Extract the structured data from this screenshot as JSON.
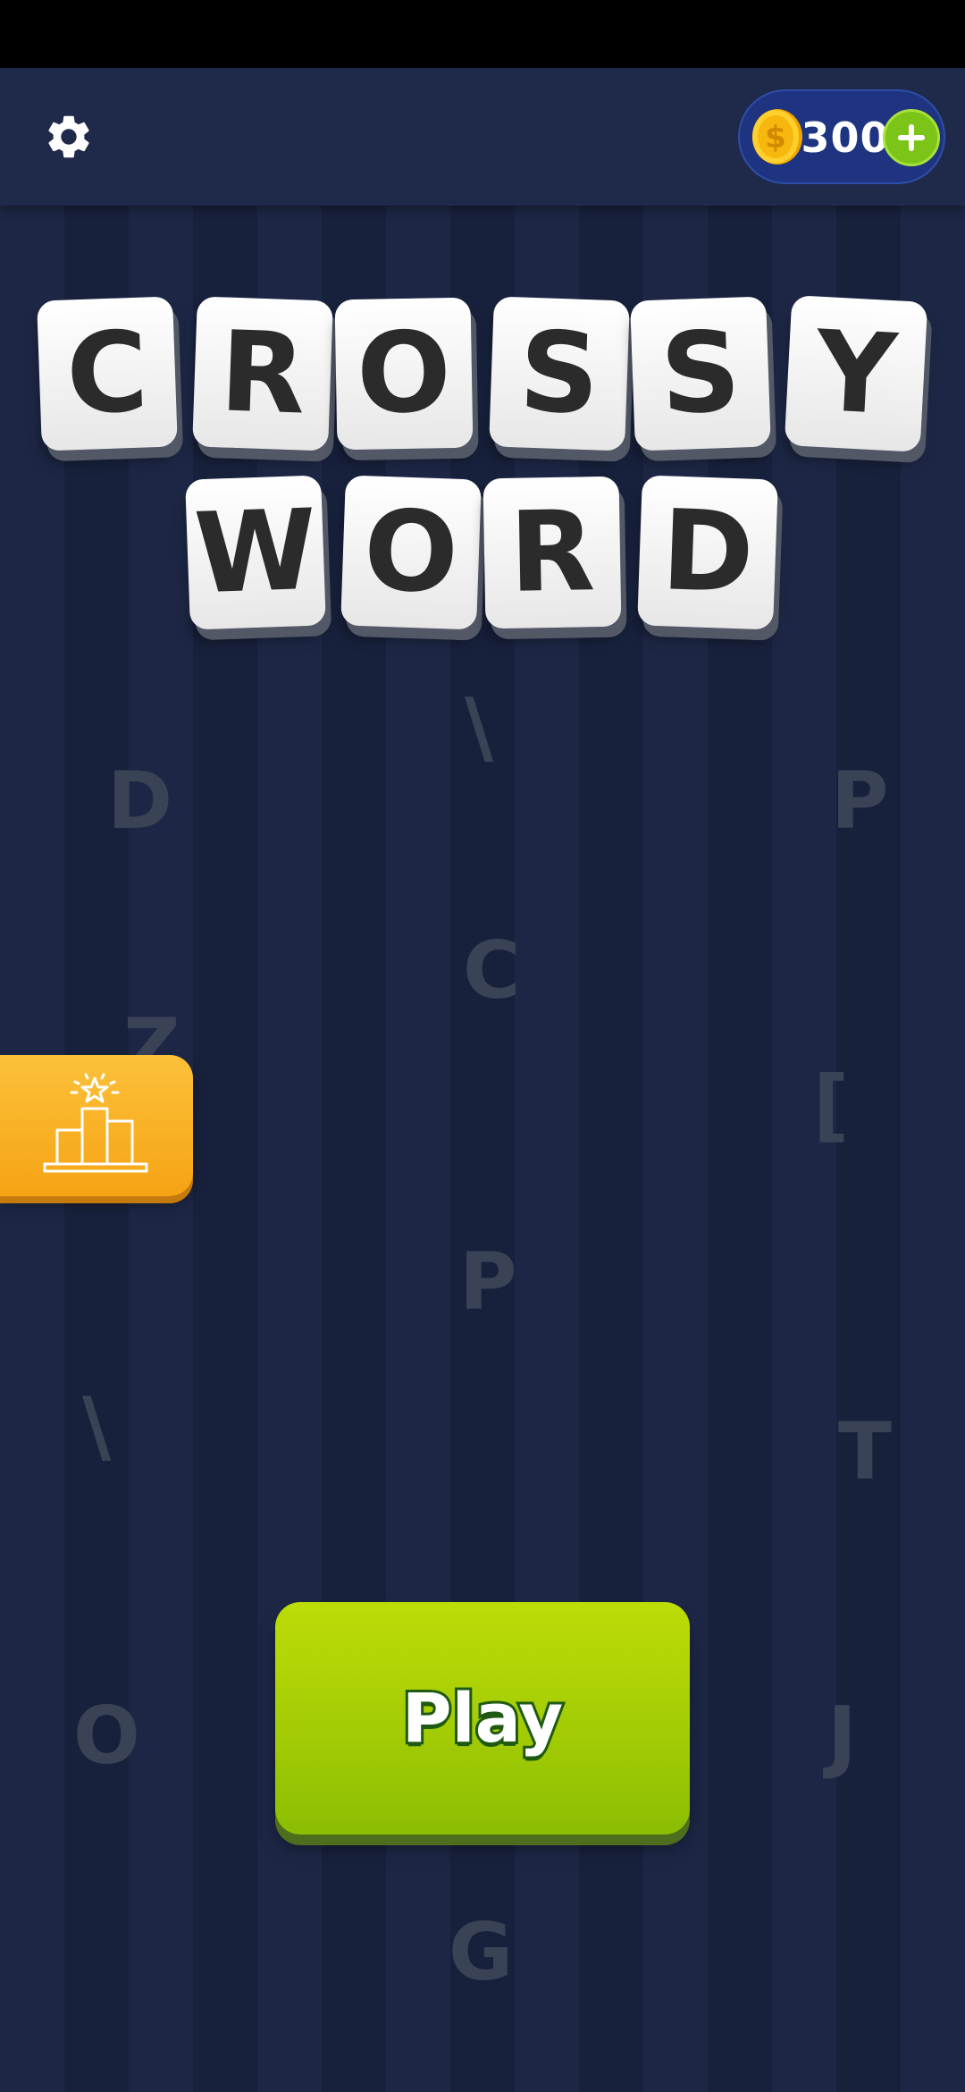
{
  "topbar": {
    "coins": "300",
    "settings_icon": "gear-icon",
    "coin_icon": "gold-coin-icon",
    "add_icon": "plus-icon"
  },
  "logo": {
    "row1": [
      "C",
      "R",
      "O",
      "S",
      "S",
      "Y"
    ],
    "row2": [
      "W",
      "O",
      "R",
      "D"
    ]
  },
  "background_letters": [
    "\\",
    "D",
    "P",
    "C",
    "Z",
    "[",
    "P",
    "\\",
    "T",
    "O",
    "J",
    "G"
  ],
  "leaderboard": {
    "icon": "podium-star-icon"
  },
  "play_button": {
    "label": "Play"
  },
  "colors": {
    "background": "#1a2440",
    "topbar": "#1f2a4a",
    "coin_box": "#1e3480",
    "play": "#a3cc05",
    "leaderboard": "#f9b125",
    "tile": "#ffffff"
  }
}
